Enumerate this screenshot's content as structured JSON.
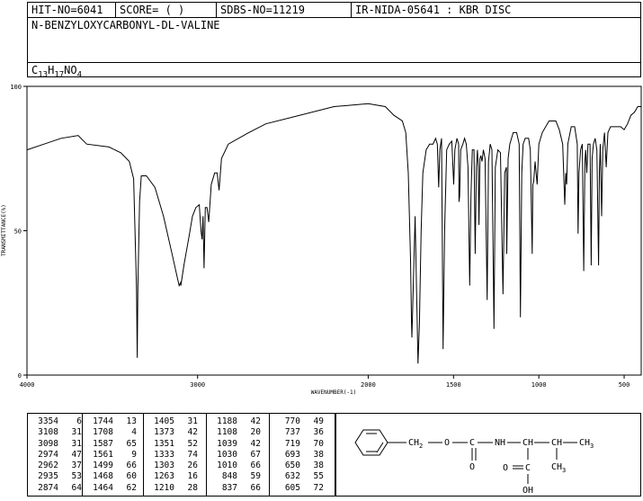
{
  "header": {
    "hit_no": "HIT-NO=6041",
    "score": "SCORE=  (   )",
    "sdbs_no": "SDBS-NO=11219",
    "ir_nida": "IR-NIDA-05641 : KBR DISC",
    "compound_name": "N-BENZYLOXYCARBONYL-DL-VALINE",
    "formula": {
      "c": "C",
      "c_n": "13",
      "h": "H",
      "h_n": "17",
      "rest": "NO",
      "o_n": "4"
    }
  },
  "chart_data": {
    "type": "line",
    "title": "",
    "xlabel": "WAVENUMBER(-1)",
    "ylabel": "TRANSMITTANCE(%)",
    "xlim": [
      4000,
      400
    ],
    "ylim": [
      0,
      100
    ],
    "x_ticks": [
      4000,
      3000,
      2000,
      1500,
      1000,
      500
    ],
    "y_ticks": [
      0,
      50,
      100
    ],
    "grid": false,
    "series": [
      {
        "name": "",
        "points": [
          [
            4000,
            78
          ],
          [
            3900,
            80
          ],
          [
            3800,
            82
          ],
          [
            3700,
            83
          ],
          [
            3650,
            80
          ],
          [
            3520,
            79
          ],
          [
            3450,
            77
          ],
          [
            3400,
            74
          ],
          [
            3375,
            68
          ],
          [
            3358,
            30
          ],
          [
            3354,
            6
          ],
          [
            3350,
            30
          ],
          [
            3340,
            60
          ],
          [
            3330,
            69
          ],
          [
            3300,
            69
          ],
          [
            3250,
            65
          ],
          [
            3200,
            55
          ],
          [
            3150,
            42
          ],
          [
            3120,
            34
          ],
          [
            3108,
            31
          ],
          [
            3100,
            32
          ],
          [
            3098,
            31
          ],
          [
            3080,
            38
          ],
          [
            3050,
            48
          ],
          [
            3030,
            55
          ],
          [
            3010,
            58
          ],
          [
            2990,
            59
          ],
          [
            2980,
            50
          ],
          [
            2974,
            47
          ],
          [
            2968,
            55
          ],
          [
            2962,
            37
          ],
          [
            2955,
            58
          ],
          [
            2945,
            58
          ],
          [
            2935,
            53
          ],
          [
            2920,
            66
          ],
          [
            2900,
            70
          ],
          [
            2885,
            70
          ],
          [
            2874,
            64
          ],
          [
            2860,
            75
          ],
          [
            2820,
            80
          ],
          [
            2700,
            84
          ],
          [
            2600,
            87
          ],
          [
            2400,
            90
          ],
          [
            2200,
            93
          ],
          [
            2000,
            94
          ],
          [
            1900,
            93
          ],
          [
            1850,
            90
          ],
          [
            1800,
            88
          ],
          [
            1780,
            84
          ],
          [
            1765,
            70
          ],
          [
            1752,
            40
          ],
          [
            1746,
            18
          ],
          [
            1744,
            13
          ],
          [
            1740,
            22
          ],
          [
            1725,
            55
          ],
          [
            1715,
            25
          ],
          [
            1708,
            4
          ],
          [
            1700,
            18
          ],
          [
            1690,
            50
          ],
          [
            1680,
            70
          ],
          [
            1660,
            78
          ],
          [
            1640,
            80
          ],
          [
            1620,
            80
          ],
          [
            1605,
            82
          ],
          [
            1595,
            80
          ],
          [
            1587,
            65
          ],
          [
            1580,
            78
          ],
          [
            1570,
            82
          ],
          [
            1561,
            9
          ],
          [
            1552,
            50
          ],
          [
            1540,
            78
          ],
          [
            1525,
            80
          ],
          [
            1510,
            81
          ],
          [
            1499,
            66
          ],
          [
            1492,
            78
          ],
          [
            1480,
            82
          ],
          [
            1470,
            80
          ],
          [
            1468,
            60
          ],
          [
            1464,
            62
          ],
          [
            1458,
            78
          ],
          [
            1445,
            80
          ],
          [
            1435,
            82
          ],
          [
            1425,
            80
          ],
          [
            1415,
            72
          ],
          [
            1405,
            31
          ],
          [
            1398,
            62
          ],
          [
            1390,
            78
          ],
          [
            1380,
            78
          ],
          [
            1373,
            42
          ],
          [
            1366,
            72
          ],
          [
            1360,
            78
          ],
          [
            1355,
            72
          ],
          [
            1351,
            52
          ],
          [
            1345,
            75
          ],
          [
            1340,
            76
          ],
          [
            1333,
            74
          ],
          [
            1325,
            78
          ],
          [
            1315,
            75
          ],
          [
            1303,
            26
          ],
          [
            1295,
            74
          ],
          [
            1285,
            80
          ],
          [
            1275,
            78
          ],
          [
            1263,
            16
          ],
          [
            1255,
            72
          ],
          [
            1240,
            78
          ],
          [
            1225,
            77
          ],
          [
            1210,
            28
          ],
          [
            1200,
            70
          ],
          [
            1190,
            72
          ],
          [
            1188,
            42
          ],
          [
            1180,
            75
          ],
          [
            1170,
            80
          ],
          [
            1150,
            84
          ],
          [
            1130,
            84
          ],
          [
            1115,
            80
          ],
          [
            1108,
            20
          ],
          [
            1100,
            70
          ],
          [
            1092,
            80
          ],
          [
            1080,
            82
          ],
          [
            1060,
            82
          ],
          [
            1050,
            78
          ],
          [
            1039,
            42
          ],
          [
            1035,
            66
          ],
          [
            1030,
            67
          ],
          [
            1022,
            74
          ],
          [
            1010,
            66
          ],
          [
            1000,
            80
          ],
          [
            980,
            84
          ],
          [
            960,
            86
          ],
          [
            940,
            88
          ],
          [
            920,
            88
          ],
          [
            900,
            88
          ],
          [
            880,
            85
          ],
          [
            860,
            80
          ],
          [
            848,
            59
          ],
          [
            842,
            70
          ],
          [
            837,
            66
          ],
          [
            830,
            80
          ],
          [
            810,
            86
          ],
          [
            790,
            86
          ],
          [
            775,
            80
          ],
          [
            770,
            49
          ],
          [
            765,
            70
          ],
          [
            755,
            78
          ],
          [
            745,
            80
          ],
          [
            737,
            36
          ],
          [
            730,
            74
          ],
          [
            725,
            78
          ],
          [
            719,
            70
          ],
          [
            712,
            80
          ],
          [
            700,
            80
          ],
          [
            693,
            38
          ],
          [
            688,
            75
          ],
          [
            680,
            80
          ],
          [
            670,
            82
          ],
          [
            660,
            78
          ],
          [
            650,
            38
          ],
          [
            645,
            70
          ],
          [
            640,
            80
          ],
          [
            632,
            55
          ],
          [
            625,
            78
          ],
          [
            615,
            84
          ],
          [
            605,
            72
          ],
          [
            595,
            84
          ],
          [
            580,
            86
          ],
          [
            560,
            86
          ],
          [
            540,
            86
          ],
          [
            520,
            86
          ],
          [
            500,
            85
          ],
          [
            480,
            87
          ],
          [
            460,
            90
          ],
          [
            440,
            91
          ],
          [
            420,
            93
          ],
          [
            400,
            93
          ]
        ]
      }
    ]
  },
  "peaks": [
    [
      [
        "3354",
        "6"
      ],
      [
        "3108",
        "31"
      ],
      [
        "3098",
        "31"
      ],
      [
        "2974",
        "47"
      ],
      [
        "2962",
        "37"
      ],
      [
        "2935",
        "53"
      ],
      [
        "2874",
        "64"
      ]
    ],
    [
      [
        "1744",
        "13"
      ],
      [
        "1708",
        "4"
      ],
      [
        "1587",
        "65"
      ],
      [
        "1561",
        "9"
      ],
      [
        "1499",
        "66"
      ],
      [
        "1468",
        "60"
      ],
      [
        "1464",
        "62"
      ]
    ],
    [
      [
        "1405",
        "31"
      ],
      [
        "1373",
        "42"
      ],
      [
        "1351",
        "52"
      ],
      [
        "1333",
        "74"
      ],
      [
        "1303",
        "26"
      ],
      [
        "1263",
        "16"
      ],
      [
        "1210",
        "28"
      ]
    ],
    [
      [
        "1188",
        "42"
      ],
      [
        "1108",
        "20"
      ],
      [
        "1039",
        "42"
      ],
      [
        "1030",
        "67"
      ],
      [
        "1010",
        "66"
      ],
      [
        "848",
        "59"
      ],
      [
        "837",
        "66"
      ]
    ],
    [
      [
        "770",
        "49"
      ],
      [
        "737",
        "36"
      ],
      [
        "719",
        "70"
      ],
      [
        "693",
        "38"
      ],
      [
        "650",
        "38"
      ],
      [
        "632",
        "55"
      ],
      [
        "605",
        "72"
      ]
    ]
  ],
  "structure": {
    "ch2": "CH",
    "ch2_n": "2",
    "o1": "O",
    "c1": "C",
    "o2": "O",
    "nh": "NH",
    "ch_a": "CH",
    "ch_b": "CH",
    "ch3a": "CH",
    "ch3a_n": "3",
    "ch3b": "CH",
    "ch3b_n": "3",
    "c2": "C",
    "o3": "O",
    "oh": "OH"
  }
}
